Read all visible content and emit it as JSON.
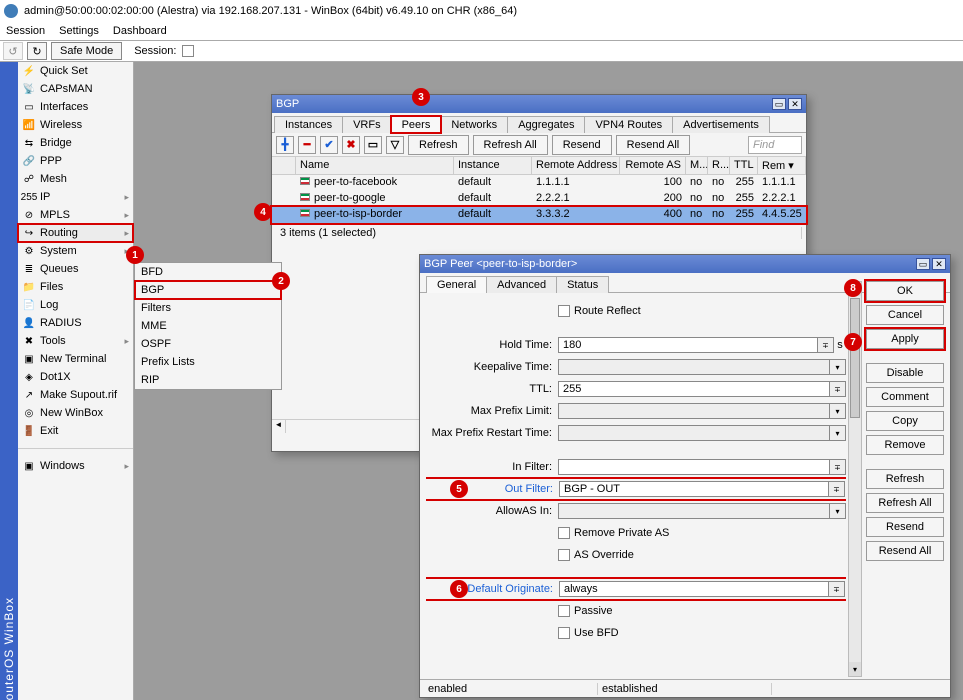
{
  "window_title": "admin@50:00:00:02:00:00 (Alestra) via 192.168.207.131 - WinBox (64bit) v6.49.10 on CHR (x86_64)",
  "menubar": {
    "session": "Session",
    "settings": "Settings",
    "dashboard": "Dashboard"
  },
  "toolbar": {
    "safe_mode": "Safe Mode",
    "session_label": "Session:"
  },
  "sidebar_label": "outerOS WinBox",
  "sidebar": {
    "items": [
      {
        "label": "Quick Set",
        "icon": "⚡"
      },
      {
        "label": "CAPsMAN",
        "icon": "📡"
      },
      {
        "label": "Interfaces",
        "icon": "▭"
      },
      {
        "label": "Wireless",
        "icon": "📶"
      },
      {
        "label": "Bridge",
        "icon": "⇆"
      },
      {
        "label": "PPP",
        "icon": "🔗"
      },
      {
        "label": "Mesh",
        "icon": "☍"
      },
      {
        "label": "IP",
        "icon": "255",
        "arrow": true
      },
      {
        "label": "MPLS",
        "icon": "⊘",
        "arrow": true
      },
      {
        "label": "Routing",
        "icon": "↪",
        "arrow": true,
        "selected": true,
        "boxed": true
      },
      {
        "label": "System",
        "icon": "⚙",
        "arrow": true
      },
      {
        "label": "Queues",
        "icon": "≣"
      },
      {
        "label": "Files",
        "icon": "📁"
      },
      {
        "label": "Log",
        "icon": "📄"
      },
      {
        "label": "RADIUS",
        "icon": "👤"
      },
      {
        "label": "Tools",
        "icon": "✖",
        "arrow": true
      },
      {
        "label": "New Terminal",
        "icon": "▣"
      },
      {
        "label": "Dot1X",
        "icon": "◈"
      },
      {
        "label": "Make Supout.rif",
        "icon": "↗"
      },
      {
        "label": "New WinBox",
        "icon": "◎"
      },
      {
        "label": "Exit",
        "icon": "🚪"
      }
    ],
    "windows_label": "Windows"
  },
  "submenu": {
    "items": [
      {
        "label": "BFD"
      },
      {
        "label": "BGP",
        "boxed": true
      },
      {
        "label": "Filters"
      },
      {
        "label": "MME"
      },
      {
        "label": "OSPF"
      },
      {
        "label": "Prefix Lists"
      },
      {
        "label": "RIP"
      }
    ]
  },
  "bgp_window": {
    "title": "BGP",
    "tabs": [
      "Instances",
      "VRFs",
      "Peers",
      "Networks",
      "Aggregates",
      "VPN4 Routes",
      "Advertisements"
    ],
    "active_tab": 2,
    "boxed_tab": 2,
    "tools": {
      "refresh": "Refresh",
      "refresh_all": "Refresh All",
      "resend": "Resend",
      "resend_all": "Resend All",
      "find": "Find"
    },
    "columns": [
      "Name",
      "Instance",
      "Remote Address",
      "Remote AS",
      "M...",
      "R...",
      "TTL",
      "Rem ▾"
    ],
    "rows": [
      {
        "name": "peer-to-facebook",
        "instance": "default",
        "remote_addr": "1.1.1.1",
        "remote_as": "100",
        "m": "no",
        "r": "no",
        "ttl": "255",
        "rem": "1.1.1.1"
      },
      {
        "name": "peer-to-google",
        "instance": "default",
        "remote_addr": "2.2.2.1",
        "remote_as": "200",
        "m": "no",
        "r": "no",
        "ttl": "255",
        "rem": "2.2.2.1"
      },
      {
        "name": "peer-to-isp-border",
        "instance": "default",
        "remote_addr": "3.3.3.2",
        "remote_as": "400",
        "m": "no",
        "r": "no",
        "ttl": "255",
        "rem": "4.4.5.25",
        "selected": true,
        "boxed": true
      }
    ],
    "status": "3 items (1 selected)"
  },
  "peer_window": {
    "title": "BGP Peer <peer-to-isp-border>",
    "tabs": [
      "General",
      "Advanced",
      "Status"
    ],
    "active_tab": 0,
    "fields": {
      "route_reflect": "Route Reflect",
      "hold_time": {
        "label": "Hold Time:",
        "value": "180",
        "unit": "s"
      },
      "keepalive": {
        "label": "Keepalive Time:",
        "value": ""
      },
      "ttl": {
        "label": "TTL:",
        "value": "255"
      },
      "max_prefix": {
        "label": "Max Prefix Limit:",
        "value": ""
      },
      "max_prefix_restart": {
        "label": "Max Prefix Restart Time:",
        "value": ""
      },
      "in_filter": {
        "label": "In Filter:",
        "value": ""
      },
      "out_filter": {
        "label": "Out Filter:",
        "value": "BGP - OUT",
        "boxed": true
      },
      "allow_as": {
        "label": "AllowAS In:",
        "value": ""
      },
      "remove_private": "Remove Private AS",
      "as_override": "AS Override",
      "default_originate": {
        "label": "Default Originate:",
        "value": "always",
        "boxed": true
      },
      "passive": "Passive",
      "use_bfd": "Use BFD"
    },
    "buttons": {
      "ok": "OK",
      "cancel": "Cancel",
      "apply": "Apply",
      "disable": "Disable",
      "comment": "Comment",
      "copy": "Copy",
      "remove": "Remove",
      "refresh": "Refresh",
      "refresh_all": "Refresh All",
      "resend": "Resend",
      "resend_all": "Resend All"
    },
    "status_left": "enabled",
    "status_right": "established"
  },
  "callouts": {
    "1": "1",
    "2": "2",
    "3": "3",
    "4": "4",
    "5": "5",
    "6": "6",
    "7": "7",
    "8": "8"
  }
}
